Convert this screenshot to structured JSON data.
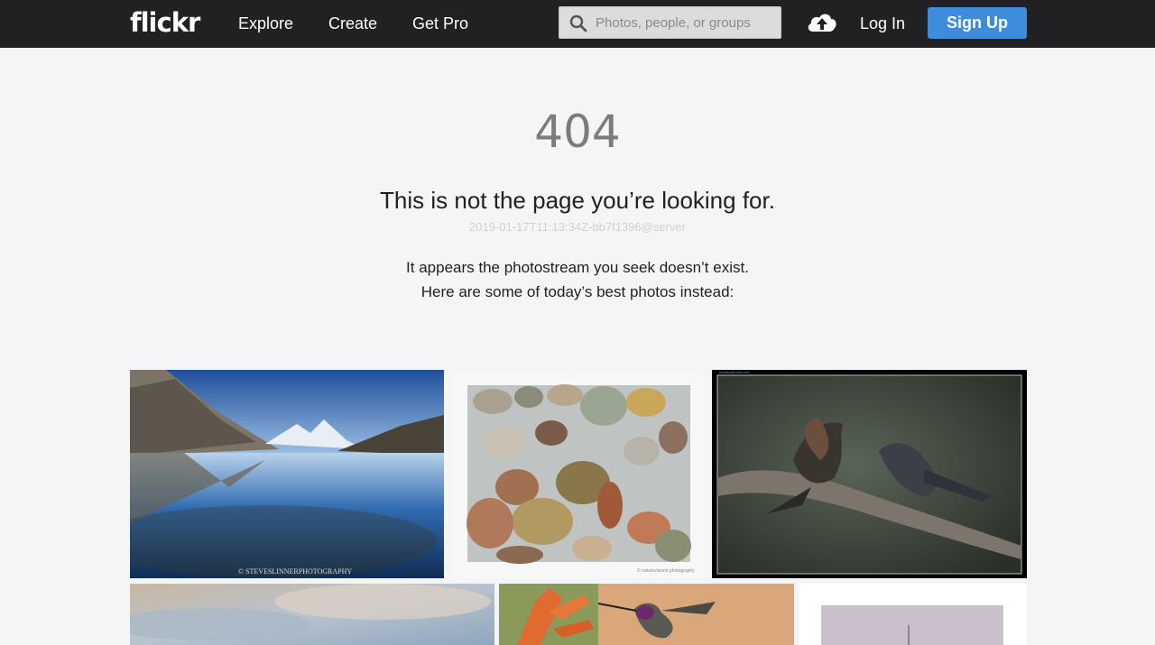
{
  "header": {
    "logo": "flickr",
    "nav": [
      "Explore",
      "Create",
      "Get Pro"
    ],
    "search_placeholder": "Photos, people, or groups",
    "login": "Log In",
    "signup": "Sign Up",
    "icons": [
      "search-icon",
      "upload-cloud-icon"
    ],
    "colors": {
      "bar": "#212124",
      "signup": "#3d8ddc"
    }
  },
  "error": {
    "code": "404",
    "headline": "This is not the page you’re looking for.",
    "trace": "2019-01-17T11:13:34Z-bb7f1396@server",
    "message_line1": "It appears the photostream you seek doesn’t exist.",
    "message_line2": "Here are some of today’s best photos instead:"
  },
  "photos": {
    "credit_watermark_1": "© STEVESLINNERPHOTOGRAPHY",
    "credit_watermark_2": "© naturevisions photography",
    "credit_watermark_3": "birdseyephoto.com"
  }
}
